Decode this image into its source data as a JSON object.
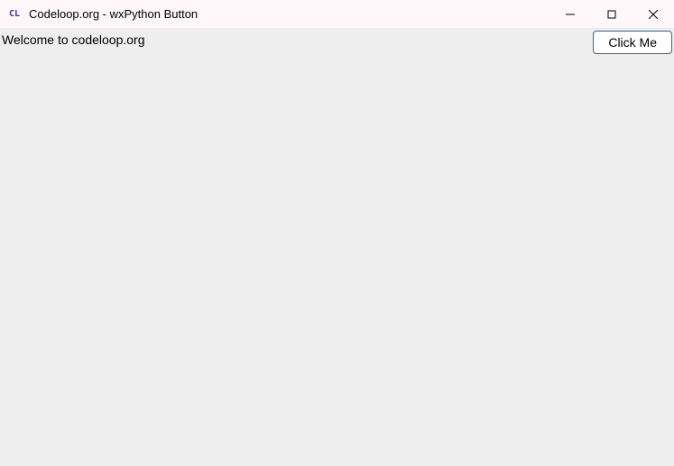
{
  "titlebar": {
    "icon_text": "CL",
    "title": "Codeloop.org - wxPython Button"
  },
  "client": {
    "welcome_text": "Welcome to codeloop.org",
    "button_label": "Click Me"
  }
}
